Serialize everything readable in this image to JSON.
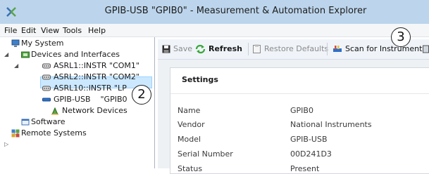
{
  "window": {
    "title": "GPIB-USB    \"GPIB0\" - Measurement & Automation Explorer"
  },
  "menu": {
    "items": [
      "File",
      "Edit",
      "View",
      "Tools",
      "Help"
    ]
  },
  "tree": {
    "root": "My System",
    "devices_interfaces": "Devices and Interfaces",
    "asrl1": "ASRL1::INSTR \"COM1\"",
    "asrl2": "ASRL2::INSTR \"COM2\"",
    "asrl10": "ASRL10::INSTR \"LP",
    "gpib_usb": "GPIB-USB    \"GPIB0",
    "network_devices": "Network Devices",
    "software": "Software",
    "remote_systems": "Remote Systems"
  },
  "toolbar": {
    "save": "Save",
    "refresh": "Refresh",
    "restore_defaults": "Restore Defaults",
    "scan": "Scan for Instruments"
  },
  "settings": {
    "title": "Settings",
    "rows": [
      {
        "label": "Name",
        "value": "GPIB0"
      },
      {
        "label": "Vendor",
        "value": "National Instruments"
      },
      {
        "label": "Model",
        "value": "GPIB-USB"
      },
      {
        "label": "Serial Number",
        "value": "00D241D3"
      },
      {
        "label": "Status",
        "value": "Present"
      }
    ]
  },
  "callouts": {
    "two": "2",
    "three": "3"
  },
  "colors": {
    "titlebar": "#bcd5ec",
    "selection": "#cce8ff",
    "selection_border": "#99d1ff"
  }
}
